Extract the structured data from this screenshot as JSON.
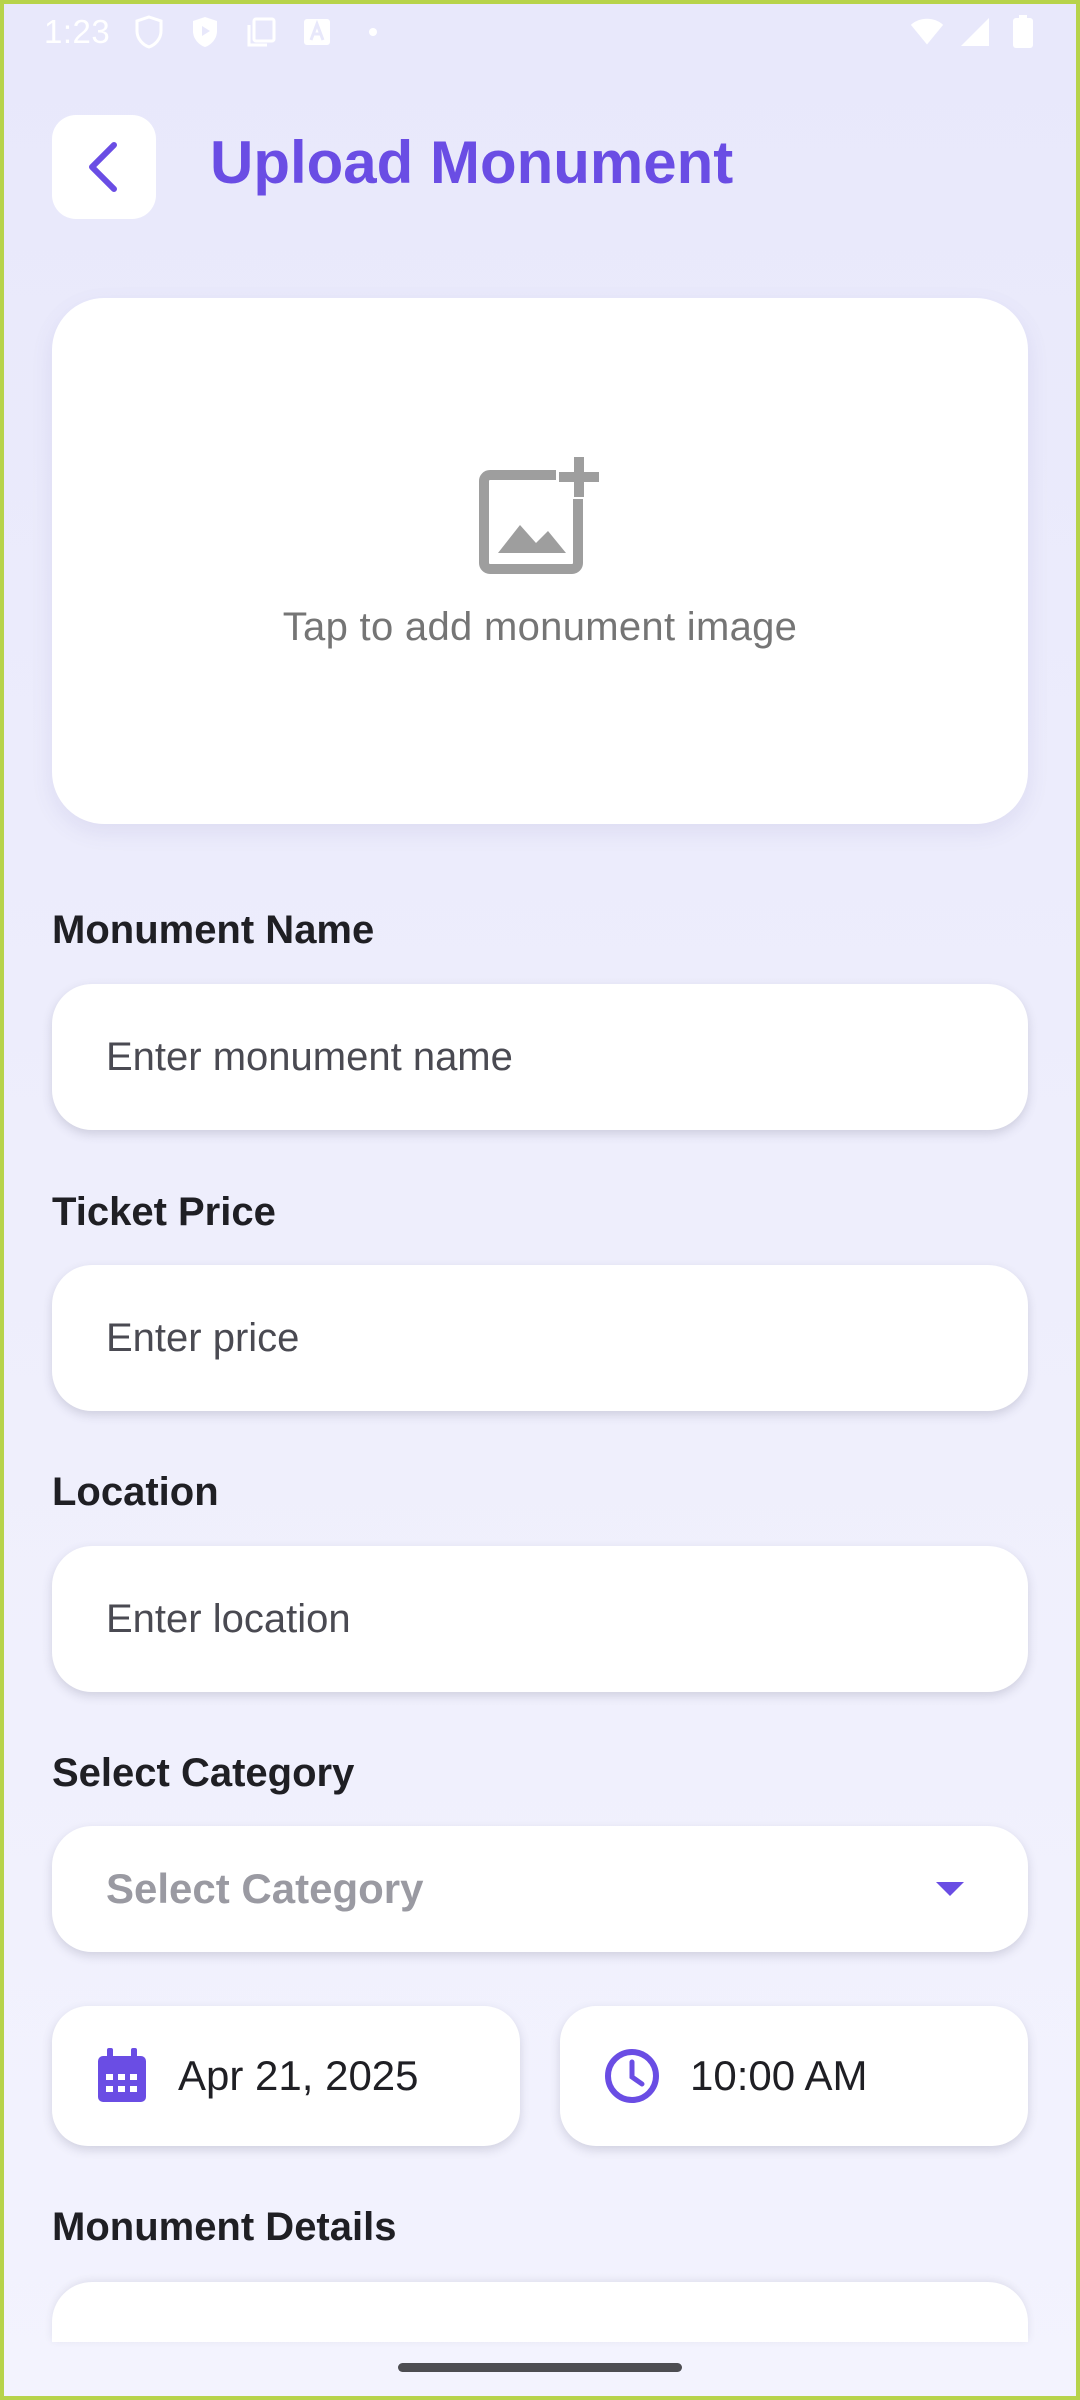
{
  "status_bar": {
    "time": "1:23",
    "icons_left": [
      "shield-icon",
      "play-protect-icon",
      "copy-icon",
      "a-badge-icon",
      "dot-icon"
    ],
    "icons_right": [
      "wifi-icon",
      "signal-icon",
      "battery-icon"
    ]
  },
  "header": {
    "title": "Upload Monument",
    "back_icon": "chevron-left-icon"
  },
  "upload": {
    "icon": "add-photo-icon",
    "text": "Tap to add monument image"
  },
  "form": {
    "name": {
      "label": "Monument Name",
      "placeholder": "Enter monument name"
    },
    "price": {
      "label": "Ticket Price",
      "placeholder": "Enter price"
    },
    "location": {
      "label": "Location",
      "placeholder": "Enter location"
    },
    "category": {
      "label": "Select Category",
      "value": "Select Category"
    },
    "date": {
      "value": "Apr 21, 2025",
      "icon": "calendar-icon"
    },
    "time": {
      "value": "10:00 AM",
      "icon": "clock-icon"
    },
    "details": {
      "label": "Monument Details"
    }
  },
  "colors": {
    "accent": "#6a4de4",
    "background": "#ebebfb",
    "card": "#ffffff",
    "muted_text": "#757575"
  }
}
